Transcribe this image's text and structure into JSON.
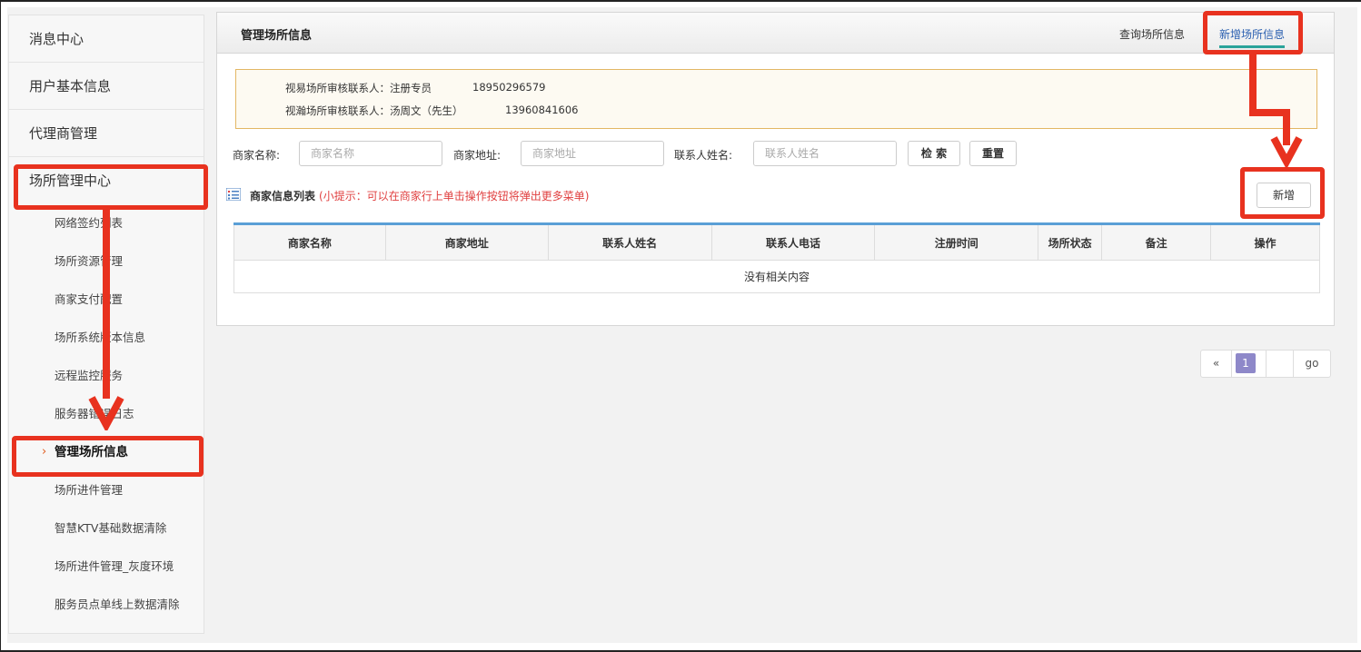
{
  "sidebar": {
    "top_items": [
      "消息中心",
      "用户基本信息",
      "代理商管理",
      "场所管理中心"
    ],
    "sub_items": [
      "网络签约列表",
      "场所资源管理",
      "商家支付配置",
      "场所系统版本信息",
      "远程监控服务",
      "服务器错误日志",
      "管理场所信息",
      "场所进件管理",
      "智慧KTV基础数据清除",
      "场所进件管理_灰度环境",
      "服务员点单线上数据清除"
    ],
    "active_chevron": "›"
  },
  "panel": {
    "title": "管理场所信息",
    "tab_query": "查询场所信息",
    "tab_add": "新增场所信息"
  },
  "notice": {
    "line1_label": "视易场所审核联系人：注册专员",
    "line1_phone": "18950296579",
    "line2_label": "视瀚场所审核联系人：汤周文（先生）",
    "line2_phone": "13960841606"
  },
  "search": {
    "name_label": "商家名称:",
    "name_placeholder": "商家名称",
    "addr_label": "商家地址:",
    "addr_placeholder": "商家地址",
    "contact_label": "联系人姓名:",
    "contact_placeholder": "联系人姓名",
    "search_btn": "检 索",
    "reset_btn": "重置"
  },
  "list": {
    "title": "商家信息列表",
    "hint": "(小提示：可以在商家行上单击操作按钮将弹出更多菜单)",
    "add_btn": "新增",
    "columns": [
      "商家名称",
      "商家地址",
      "联系人姓名",
      "联系人电话",
      "注册时间",
      "场所状态",
      "备注",
      "操作"
    ],
    "empty_text": "没有相关内容"
  },
  "pager": {
    "prev": "«",
    "current": "1",
    "go": "go"
  },
  "colors": {
    "annotation": "#e8321f",
    "table_top_border": "#5a9fd6",
    "pager_current": "#8e88c9",
    "hint": "#e04040"
  }
}
